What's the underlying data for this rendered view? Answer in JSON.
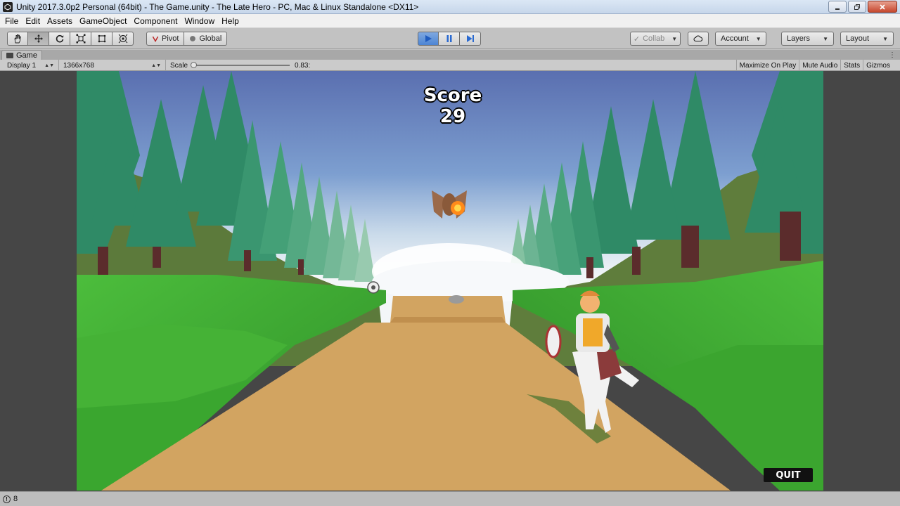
{
  "window": {
    "title": "Unity 2017.3.0p2 Personal (64bit) - The Game.unity - The Late Hero - PC, Mac & Linux Standalone <DX11>",
    "app_icon": "unity-logo-icon"
  },
  "menu": [
    "File",
    "Edit",
    "Assets",
    "GameObject",
    "Component",
    "Window",
    "Help"
  ],
  "toolbar": {
    "tools": [
      "hand-tool-icon",
      "move-tool-icon",
      "rotate-tool-icon",
      "scale-tool-icon",
      "rect-tool-icon",
      "transform-tool-icon"
    ],
    "active_tool": "move-tool-icon",
    "pivot_label": "Pivot",
    "global_label": "Global",
    "playback": [
      "play-icon",
      "pause-icon",
      "step-icon"
    ],
    "collab_label": "Collab",
    "account_label": "Account",
    "layers_label": "Layers",
    "layout_label": "Layout"
  },
  "tab": {
    "label": "Game"
  },
  "game_view": {
    "display": "Display 1",
    "resolution": "1366x768",
    "scale_label": "Scale",
    "scale_value": "0.83:",
    "options": [
      "Maximize On Play",
      "Mute Audio",
      "Stats",
      "Gizmos"
    ]
  },
  "game": {
    "score_label": "Score",
    "score_value": "29",
    "quit_label": "QUIT",
    "colors": {
      "sky_top": "#5d74b5",
      "sky_bottom": "#e8eef4",
      "grass": "#3fae34",
      "path": "#d2a461",
      "tree": "#2f8a66"
    }
  },
  "status": {
    "count": "8"
  }
}
